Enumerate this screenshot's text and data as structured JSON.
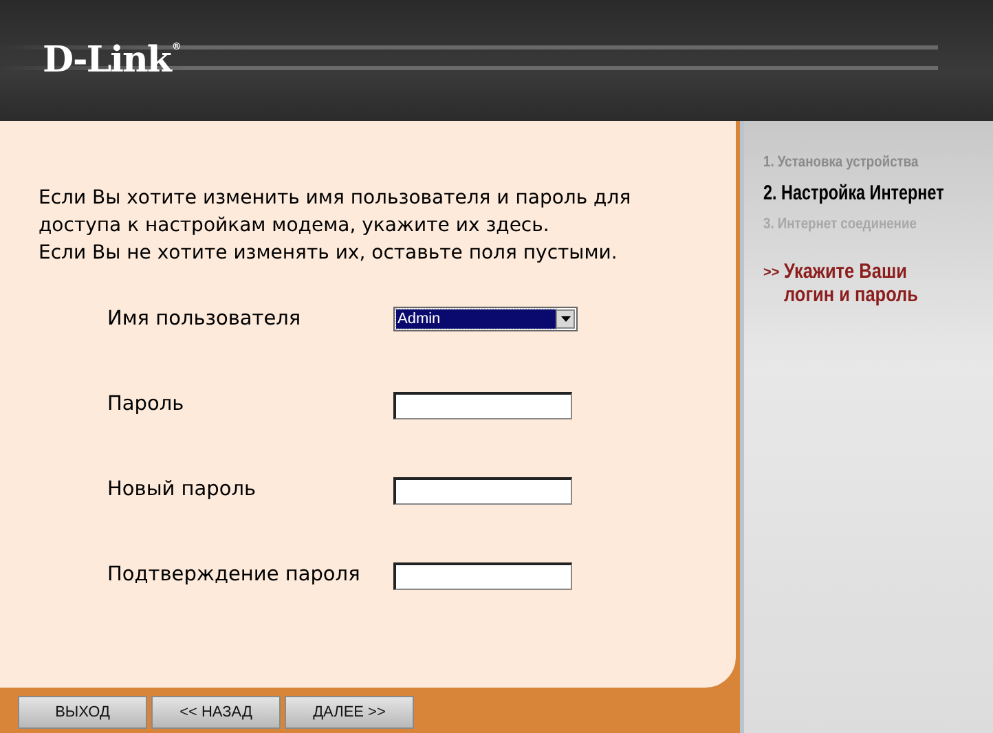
{
  "header": {
    "logo": "D-Link",
    "registered": "®"
  },
  "intro": [
    "Если Вы хотите изменить имя пользователя и пароль для доступа к настройкам модема, укажите их здесь.",
    "Если Вы не хотите изменять их, оставьте поля пустыми."
  ],
  "fields": [
    {
      "label": "Имя пользователя",
      "kind": "dropdown",
      "value": "Admin"
    },
    {
      "label": "Пароль",
      "kind": "password"
    },
    {
      "label": "Новый пароль",
      "kind": "password"
    },
    {
      "label": "Подтверждение пароля",
      "kind": "password"
    }
  ],
  "buttons": [
    "ВЫХОД",
    "<< НАЗАД",
    "ДАЛЕЕ >>"
  ],
  "steps": [
    {
      "label": "1. Установка устройства",
      "kind": "done"
    },
    {
      "label": "2. Настройка Интернет",
      "kind": "current"
    },
    {
      "label": "3. Интернет соединение",
      "kind": "pending"
    }
  ],
  "hint": {
    "marker": ">>",
    "text": "Укажите Ваши логин и пароль"
  }
}
